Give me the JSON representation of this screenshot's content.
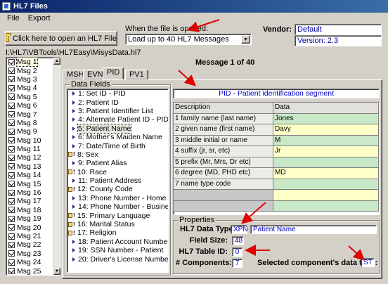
{
  "window": {
    "title": "HL7 Files"
  },
  "menu": [
    "File",
    "Export"
  ],
  "open_button": {
    "label": "Click here to open an HL7 File"
  },
  "when_opened": {
    "label": "When the file is opened:",
    "selected": "Load up to 40 HL7 Messages"
  },
  "vendor": {
    "label": "Vendor:",
    "value": "Default",
    "version": "Version: 2.3"
  },
  "file_path": "I:\\HL7\\VBTools\\HL7Easy\\MisysData.hl7",
  "message_heading": "Message 1 of 40",
  "messages": [
    "Msg 1",
    "Msg 2",
    "Msg 3",
    "Msg 4",
    "Msg 5",
    "Msg 6",
    "Msg 7",
    "Msg 8",
    "Msg 9",
    "Msg 10",
    "Msg 11",
    "Msg 12",
    "Msg 13",
    "Msg 14",
    "Msg 15",
    "Msg 16",
    "Msg 17",
    "Msg 18",
    "Msg 19",
    "Msg 20",
    "Msg 21",
    "Msg 22",
    "Msg 23",
    "Msg 24",
    "Msg 25"
  ],
  "selected_message_index": 0,
  "tabs": [
    "MSH",
    "EVN",
    "PID",
    "PV1"
  ],
  "active_tab": "PID",
  "data_fields_title": "Data Fields",
  "fields": [
    {
      "label": "1: Set ID - PID",
      "required": false
    },
    {
      "label": "2: Patient ID",
      "required": false
    },
    {
      "label": "3: Patient Identifier List",
      "required": false
    },
    {
      "label": "4: Alternate Patient ID - PID",
      "required": false
    },
    {
      "label": "5: Patient Name",
      "required": false,
      "selected": true
    },
    {
      "label": "6: Mother's Maiden Name",
      "required": false
    },
    {
      "label": "7: Date/Time of Birth",
      "required": false
    },
    {
      "label": "8: Sex",
      "required": true
    },
    {
      "label": "9: Patient Alias",
      "required": false
    },
    {
      "label": "10: Race",
      "required": true
    },
    {
      "label": "11: Patient Address",
      "required": false
    },
    {
      "label": "12: County Code",
      "required": true
    },
    {
      "label": "13: Phone Number - Home",
      "required": false
    },
    {
      "label": "14: Phone Number - Business",
      "required": false
    },
    {
      "label": "15: Primary Language",
      "required": true
    },
    {
      "label": "16: Marital Status",
      "required": true
    },
    {
      "label": "17: Religion",
      "required": true
    },
    {
      "label": "18: Patient Account Number",
      "required": false
    },
    {
      "label": "19: SSN Number - Patient",
      "required": false
    },
    {
      "label": "20: Driver's License Number - P",
      "required": false
    }
  ],
  "segment_header": "PID - Patient identification segment",
  "grid": {
    "columns": [
      "Description",
      "Data"
    ],
    "rows": [
      {
        "desc": "1 family name (last name)",
        "data": "Jones"
      },
      {
        "desc": "2 given name (first name)",
        "data": "Davy"
      },
      {
        "desc": "3 middle initial or name",
        "data": "M"
      },
      {
        "desc": "4 suffix (jr, sr, etc)",
        "data": "Jr"
      },
      {
        "desc": "5 prefix (Mr, Mrs, Dr etc)",
        "data": ""
      },
      {
        "desc": "6 degree (MD, PHD etc)",
        "data": "MD"
      },
      {
        "desc": "7 name type code",
        "data": ""
      },
      {
        "desc": "",
        "data": ""
      },
      {
        "desc": "",
        "data": ""
      }
    ]
  },
  "properties": {
    "title": "Properties",
    "data_type_label": "HL7 Data Type:",
    "data_type": "XPN",
    "data_type_name": "Patient Name",
    "field_size_label": "Field Size:",
    "field_size": "48",
    "table_id_label": "HL7 Table ID:",
    "table_id": "0",
    "components_label": "# Components:",
    "components": "7",
    "selected_type_label": "Selected component's data type:",
    "selected_type": "ST"
  },
  "colors": {
    "title_bar": "#0a246a",
    "accent_arrow": "#e00000",
    "value_text": "#0000c8"
  }
}
